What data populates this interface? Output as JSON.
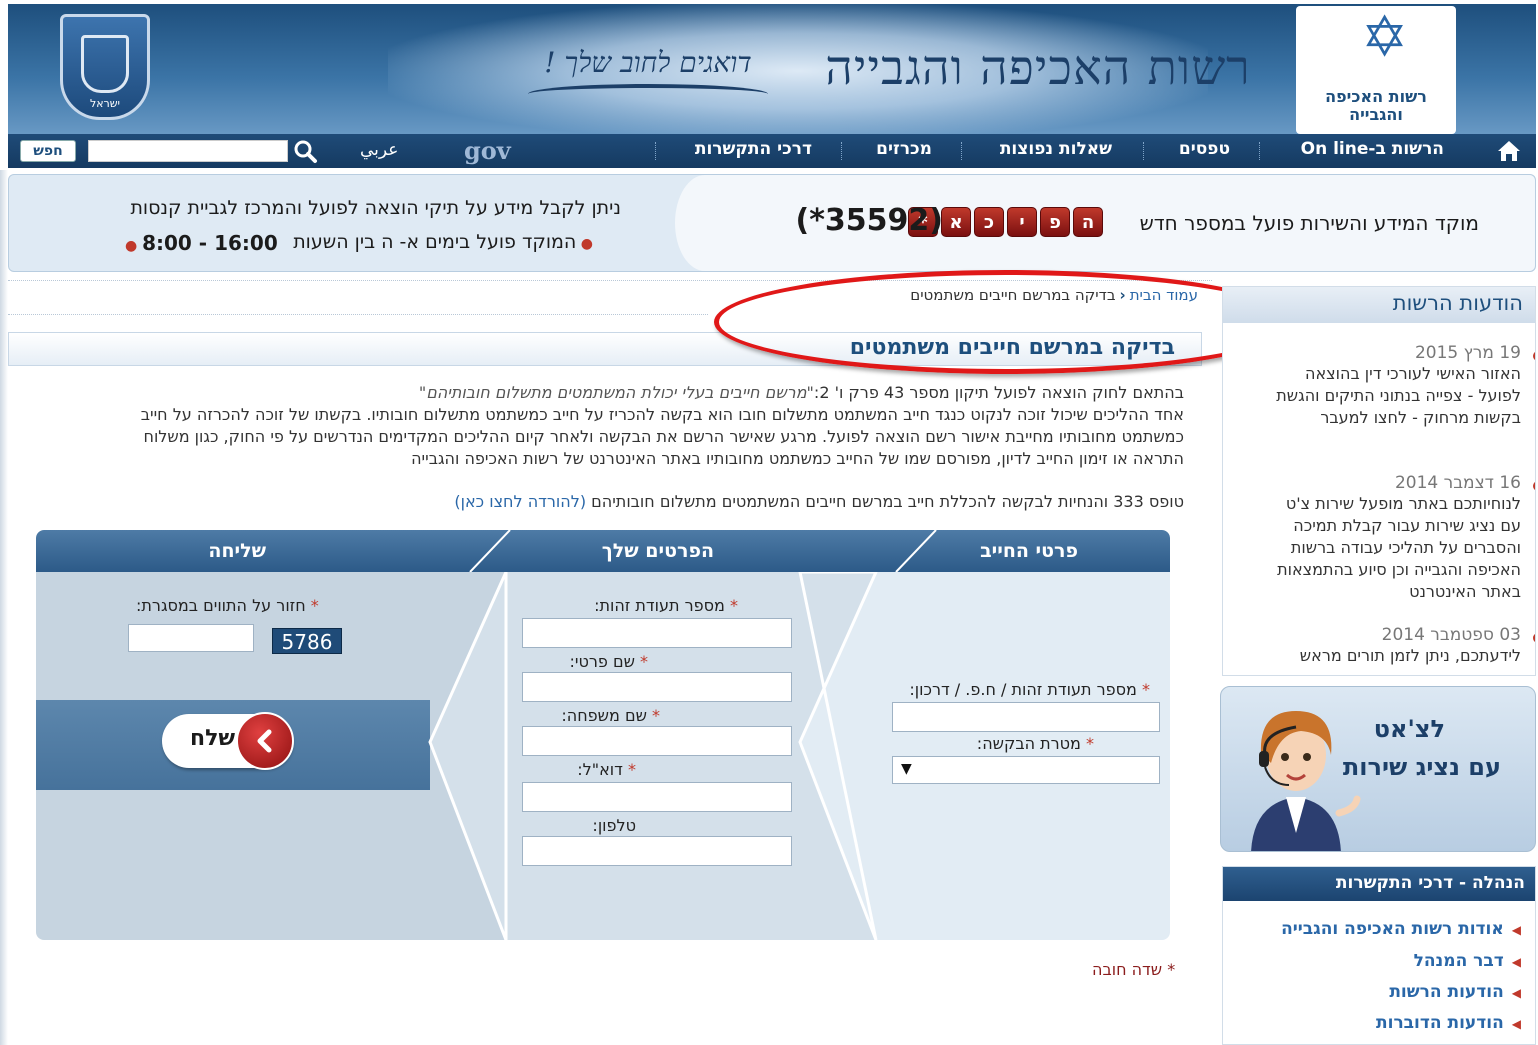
{
  "header": {
    "site_title": "רשות האכיפה והגבייה",
    "slogan": "דואגים לחוב שלך !",
    "logo_text": "רשות האכיפה והגבייה",
    "emblem_label": "ישראל"
  },
  "nav": {
    "items": [
      "הרשות ב-On line",
      "טפסים",
      "שאלות נפוצות",
      "מכרזים",
      "דרכי התקשרות"
    ],
    "search_button": "חפש",
    "arabic_link": "عربي",
    "gov_logo": "gov"
  },
  "banner": {
    "hotline_text": "מוקד המידע והשירות פועל במספר חדש",
    "star_letters": [
      "*",
      "א",
      "כ",
      "י",
      "פ",
      "ה"
    ],
    "star_number": "(*35592)",
    "left_line1": "ניתן לקבל מידע על תיקי הוצאה לפועל והמרכז לגביית קנסות",
    "left_line2": "המוקד פועל בימים א- ה בין השעות",
    "hours": "8:00 - 16:00"
  },
  "breadcrumb": {
    "home": "עמוד הבית",
    "current": "בדיקה במרשם חייבים משתמטים"
  },
  "page_title": "בדיקה במרשם חייבים משתמטים",
  "intro": {
    "line1_prefix": "בהתאם לחוק הוצאה לפועל תיקון מספר 43 פרק ו' 2:",
    "line1_quote": "\"מרשם חייבים בעלי יכולת המשתמטים מתשלום חובותיהם\"",
    "line2": "אחד ההליכים שיכול זוכה לנקוט כנגד חייב המשתמט מתשלום חובו הוא בקשה להכריז על חייב כמשתמט מתשלום חובותיו. בקשתו של זוכה להכרזה על חייב",
    "line3": "כמשתמט מחובותיו מחייבת אישור רשם הוצאה לפועל. מרגע שאישר הרשם את הבקשה ולאחר קיום ההליכים המקדימים הנדרשים על פי החוק, כגון משלוח",
    "line4": "התראה או זימון החייב לדיון, מפורסם שמו של החייב כמשתמט מחובותיו באתר האינטרנט של רשות האכיפה והגבייה"
  },
  "form_link": {
    "text": "טופס 333 והנחיות לבקשה להכללת חייב במרשם חייבים המשתמטים מתשלום חובותיהם",
    "link": "(להורדה לחצו כאן)"
  },
  "form": {
    "col_debtor": "פרטי החייב",
    "col_personal": "הפרטים שלך",
    "col_send": "שליחה",
    "debtor_id_label": "מספר תעודת זהות / ח.פ. / דרכון:",
    "request_purpose_label": "מטרת הבקשה:",
    "id_label": "מספר תעודת זהות:",
    "first_name_label": "שם פרטי:",
    "last_name_label": "שם משפחה:",
    "email_label": "דוא\"ל:",
    "phone_label": "טלפון:",
    "captcha_label": "חזור על התווים במסגרת:",
    "captcha_code": "5786",
    "send_button": "שלח",
    "required_mark": "*",
    "dropdown_arrow": "▼"
  },
  "required_note": "* שדה חובה",
  "news": {
    "title": "הודעות הרשות",
    "items": [
      {
        "date": "19 מרץ 2015",
        "text": "האזור האישי לעורכי דין בהוצאה לפועל - צפייה בנתוני התיקים והגשת בקשות מרחוק - לחצו למעבר"
      },
      {
        "date": "16 דצמבר 2014",
        "text": "לנוחיותכם באתר מופעל שירות צ'ט עם נציג שירות עבור קבלת תמיכה והסברים על תהליכי עבודה ברשות האכיפה והגבייה וכן סיוע בהתמצאות באתר האינטרנט"
      },
      {
        "date": "03 ספטמבר 2014",
        "text": "לידעתכם, ניתן לזמן תורים מראש"
      }
    ]
  },
  "chat": {
    "title": "לצ'אט",
    "subtitle": "עם נציג שירות"
  },
  "links": {
    "title": "הנהלה - דרכי התקשרות",
    "items": [
      "אודות רשות האכיפה והגבייה",
      "דבר המנהל",
      "הודעות הרשות",
      "הודעות הדוברות"
    ]
  },
  "colors": {
    "header_blue": "#1e4f7d",
    "accent_red": "#c0392b",
    "link_blue": "#2a67a8",
    "annotation_red": "#e01818"
  }
}
